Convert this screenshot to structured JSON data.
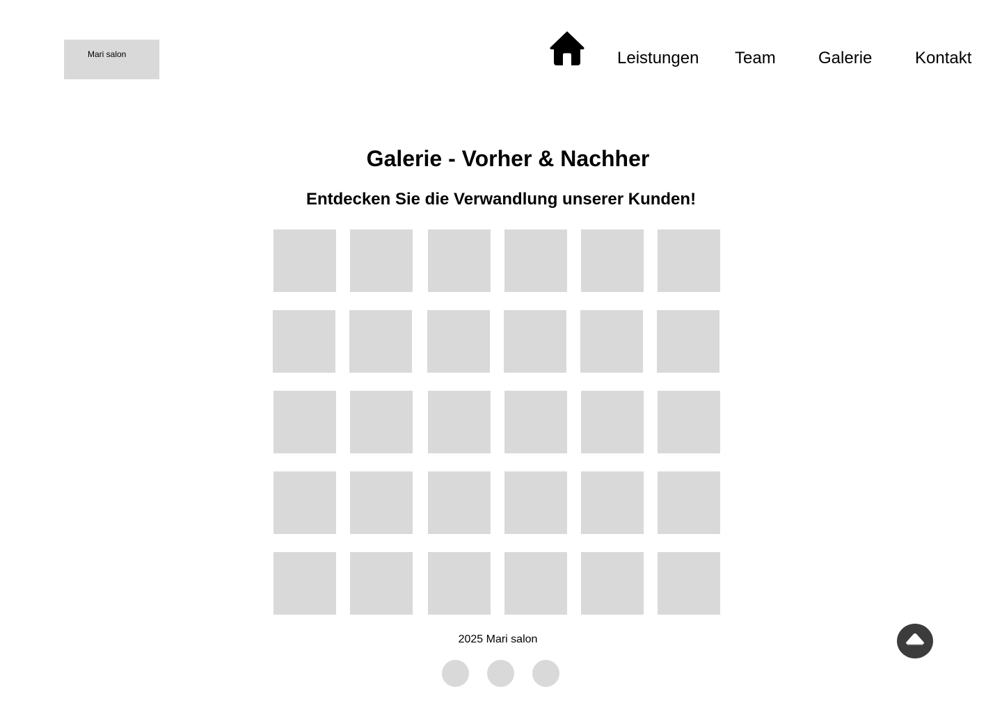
{
  "header": {
    "logo_text": "Mari salon",
    "home_icon": "home-icon",
    "nav": {
      "leistungen": "Leistungen",
      "team": "Team",
      "galerie": "Galerie",
      "kontakt": "Kontakt"
    }
  },
  "main": {
    "title": "Galerie - Vorher & Nachher",
    "subtitle": "Entdecken Sie die Verwandlung unserer Kunden!",
    "gallery": {
      "rows": 5,
      "columns": 6,
      "tile_color": "#d9d9d9"
    }
  },
  "footer": {
    "copyright": "2025 Mari salon",
    "social_icon_color": "#d9d9d9",
    "scroll_top_icon": "caret-up-icon",
    "scroll_top_color": "#3c3c3c"
  }
}
